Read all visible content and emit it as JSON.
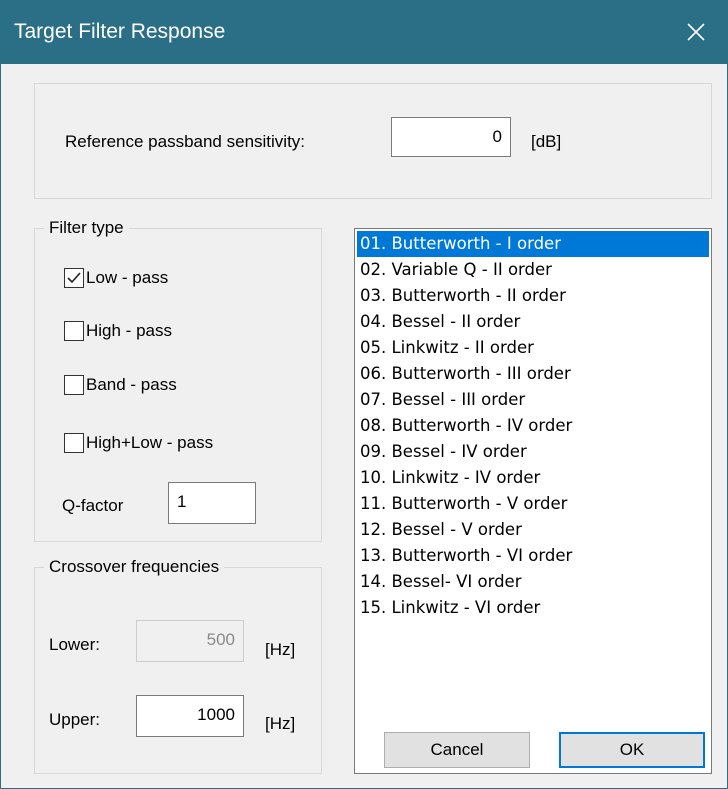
{
  "window": {
    "title": "Target Filter Response"
  },
  "reference": {
    "label": "Reference passband sensitivity:",
    "value": "0",
    "unit": "[dB]"
  },
  "filter_type": {
    "legend": "Filter type",
    "options": [
      {
        "label": "Low - pass",
        "checked": true
      },
      {
        "label": "High - pass",
        "checked": false
      },
      {
        "label": "Band - pass",
        "checked": false
      },
      {
        "label": "High+Low - pass",
        "checked": false
      }
    ],
    "q_label": "Q-factor",
    "q_value": "1"
  },
  "crossover": {
    "legend": "Crossover frequencies",
    "lower_label": "Lower:",
    "lower_value": "500",
    "lower_unit": "[Hz]",
    "upper_label": "Upper:",
    "upper_value": "1000",
    "upper_unit": "[Hz]"
  },
  "filter_list": {
    "selected_index": 0,
    "items": [
      "01. Butterworth - I order",
      "02. Variable Q - II order",
      "03. Butterworth - II order",
      "04. Bessel - II order",
      "05. Linkwitz - II order",
      "06. Butterworth - III order",
      "07. Bessel - III order",
      "08. Butterworth - IV order",
      "09. Bessel - IV order",
      "10. Linkwitz - IV order",
      "11. Butterworth - V order",
      "12. Bessel - V order",
      "13. Butterworth - VI order",
      "14. Bessel- VI order",
      "15. Linkwitz - VI order"
    ]
  },
  "buttons": {
    "cancel": "Cancel",
    "ok": "OK"
  },
  "colors": {
    "titlebar": "#2b6f86",
    "selection": "#0078d7"
  },
  "icons": {
    "close": "close-icon",
    "check": "checkmark-icon"
  }
}
